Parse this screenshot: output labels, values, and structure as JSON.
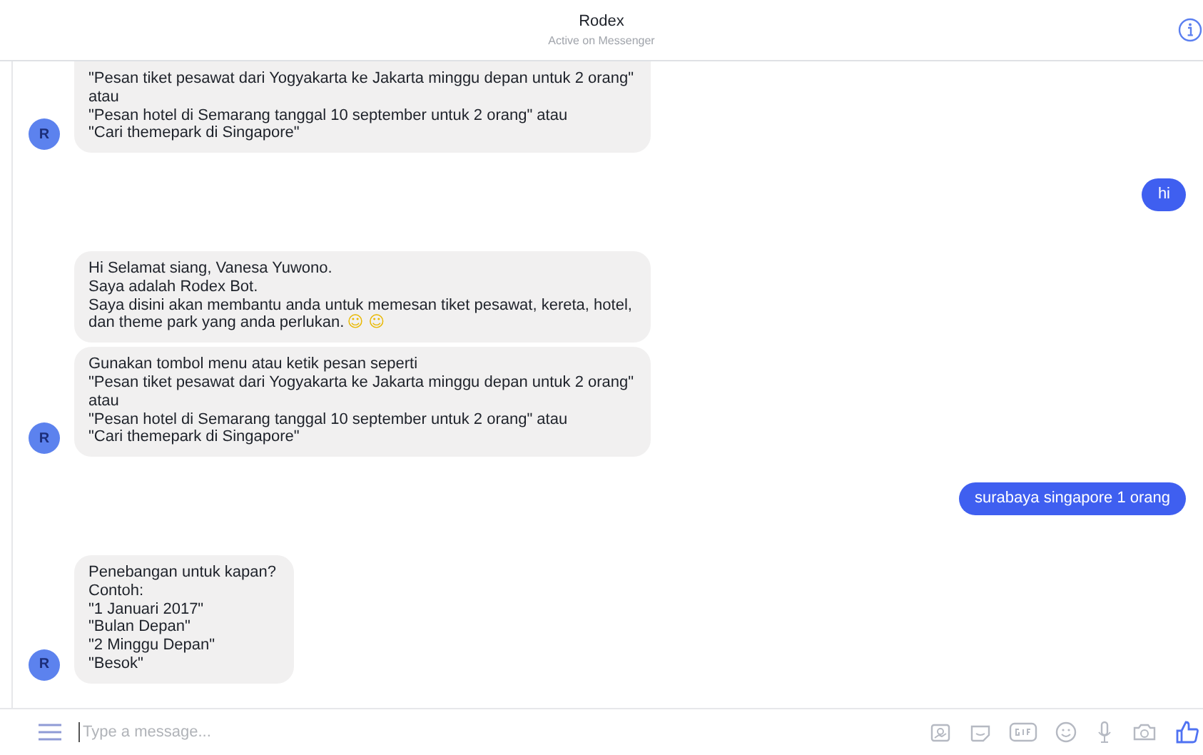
{
  "header": {
    "title": "Rodex",
    "subtitle": "Active on Messenger"
  },
  "messages": [
    {
      "kind": "bot",
      "avatar": "R",
      "cut_top": true,
      "bubbles": [
        {
          "lines": [
            {
              "text": "\"Pesan tiket pesawat dari Yogyakarta ke Jakarta minggu depan untuk 2 orang\""
            },
            {
              "text": "atau"
            },
            {
              "text": "\"Pesan hotel di Semarang tanggal 10 september untuk 2 orang\" atau"
            },
            {
              "text": "\"Cari themepark di Singapore\""
            }
          ]
        }
      ]
    },
    {
      "kind": "user",
      "bubbles": [
        {
          "lines": [
            {
              "text": "hi"
            }
          ]
        }
      ]
    },
    {
      "kind": "bot",
      "avatar": "R",
      "cut_top": false,
      "bubbles": [
        {
          "lines": [
            {
              "text": "Hi Selamat siang, Vanesa Yuwono."
            },
            {
              "text": "Saya adalah Rodex Bot."
            },
            {
              "text": "Saya disini akan membantu anda untuk memesan tiket pesawat, kereta, hotel,"
            },
            {
              "text": "dan theme park yang anda perlukan.",
              "emoji": "☺ ☺"
            }
          ]
        },
        {
          "lines": [
            {
              "text": "Gunakan tombol menu atau ketik pesan seperti"
            },
            {
              "text": "\"Pesan tiket pesawat dari Yogyakarta ke Jakarta minggu depan untuk 2 orang\""
            },
            {
              "text": "atau"
            },
            {
              "text": "\"Pesan hotel di Semarang tanggal 10 september untuk 2 orang\" atau"
            },
            {
              "text": "\"Cari themepark di Singapore\""
            }
          ]
        }
      ]
    },
    {
      "kind": "user",
      "bubbles": [
        {
          "lines": [
            {
              "text": "surabaya singapore 1 orang"
            }
          ]
        }
      ]
    },
    {
      "kind": "bot",
      "avatar": "R",
      "cut_top": false,
      "bubbles": [
        {
          "lines": [
            {
              "text": "Penebangan untuk kapan?"
            },
            {
              "text": "Contoh:"
            },
            {
              "text": "\"1 Januari 2017\""
            },
            {
              "text": "\"Bulan Depan\""
            },
            {
              "text": "\"2 Minggu Depan\""
            },
            {
              "text": "\"Besok\""
            }
          ]
        }
      ]
    }
  ],
  "composer": {
    "placeholder": "Type a message..."
  }
}
